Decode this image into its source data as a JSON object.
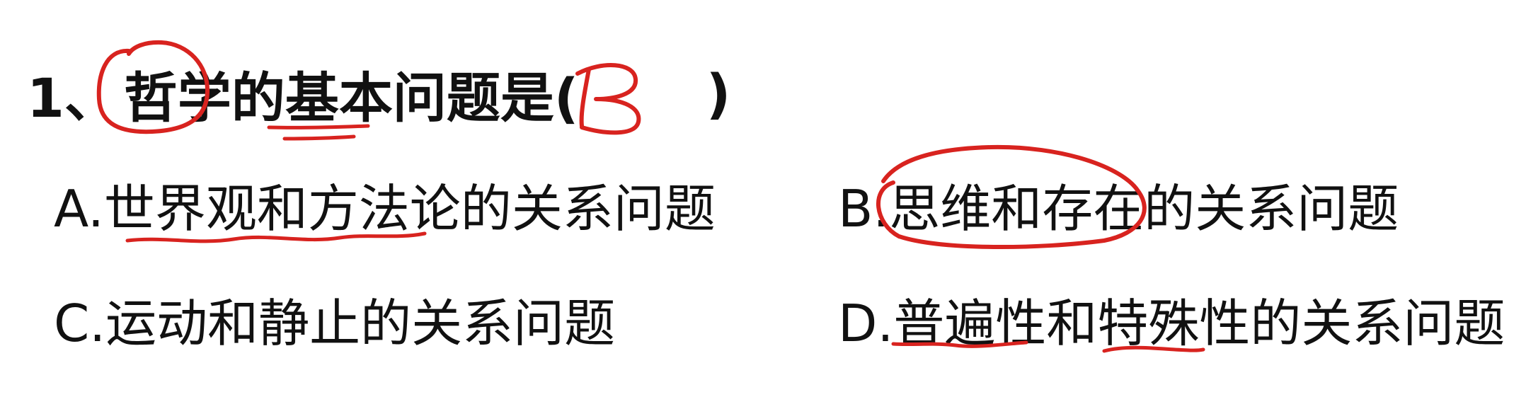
{
  "question": {
    "number": "1、",
    "text": "哲学的基本问题是(",
    "close_paren": ")",
    "handwritten_answer": "B"
  },
  "options": {
    "a": "A.世界观和方法论的关系问题",
    "b": "B.思维和存在的关系问题",
    "c": "C.运动和静止的关系问题",
    "d": "D.普遍性和特殊性的关系问题"
  },
  "colors": {
    "text": "#111111",
    "annotation_ink": "#d8231f"
  }
}
